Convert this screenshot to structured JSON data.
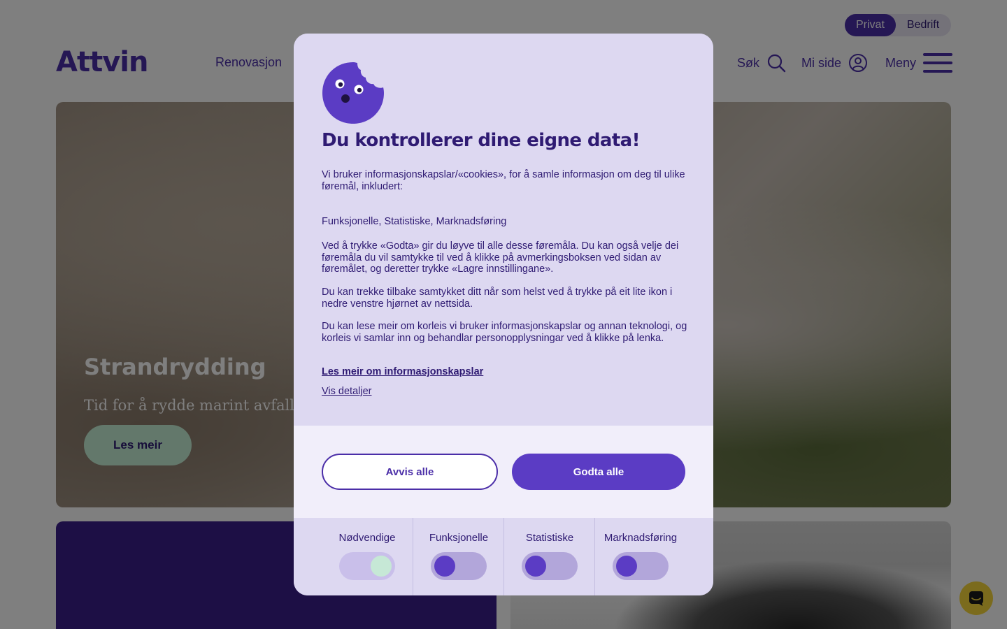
{
  "header": {
    "segments": [
      "Privat",
      "Bedrift"
    ],
    "logo": "Attvin",
    "nav_link": "Renovasjon",
    "search_label": "Søk",
    "mypage_label": "Mi side",
    "menu_label": "Meny"
  },
  "hero": {
    "title": "Strandrydding",
    "subtitle": "Tid for å rydde marint avfall! I",
    "button": "Les meir"
  },
  "dialog": {
    "title": "Du kontrollerer dine eigne data!",
    "intro": "Vi bruker informasjonskapslar/«cookies», for å samle informasjon om deg til ulike føremål, inkludert:",
    "purposes": "Funksjonelle, Statistiske, Marknadsføring",
    "consent_text": "Ved å trykke «Godta» gir du løyve til alle desse føremåla. Du kan også velje dei føremåla du vil samtykke til ved å klikke på avmerkingsboksen ved sidan av føremålet, og deretter trykke «Lagre innstillingane».",
    "withdraw_text": "Du kan trekke tilbake samtykket ditt når som helst ved å trykke på eit lite ikon i nedre venstre hjørnet av nettsida.",
    "more_text": "Du kan lese meir om korleis vi bruker informasjonskapslar og annan teknologi, og korleis vi samlar inn og behandlar personopplysningar ved å klikke på lenka.",
    "read_more_link": "Les meir om informasjonskapslar",
    "details_link": "Vis detaljer",
    "reject_button": "Avvis alle",
    "accept_button": "Godta alle",
    "toggles": [
      {
        "label": "Nødvendige",
        "state": "on-locked"
      },
      {
        "label": "Funksjonelle",
        "state": "off"
      },
      {
        "label": "Statistiske",
        "state": "off"
      },
      {
        "label": "Marknadsføring",
        "state": "off"
      }
    ]
  },
  "colors": {
    "brand_purple": "#4b2ea8",
    "accent_green": "#c6f1d7",
    "chat_yellow": "#f7d63a"
  }
}
